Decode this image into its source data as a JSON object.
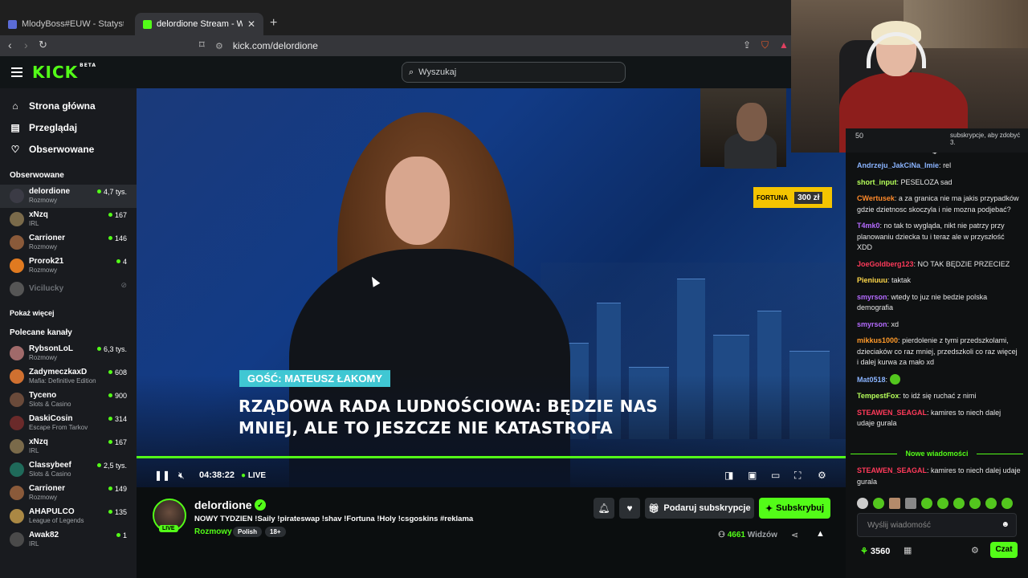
{
  "browser": {
    "tabs": [
      {
        "title": "MlodyBoss#EUW - Statystyki przywo",
        "favicon_color": "#5b6cd6"
      },
      {
        "title": "delordione Stream - Watch Live",
        "favicon_color": "#53fc18"
      }
    ],
    "new_tab": "+",
    "url": "kick.com/delordione"
  },
  "header": {
    "logo": "KICK",
    "logo_badge": "BETA",
    "search_placeholder": "Wyszukaj"
  },
  "sidebar": {
    "nav": [
      {
        "label": "Strona główna",
        "icon": "home-icon"
      },
      {
        "label": "Przeglądaj",
        "icon": "browse-icon"
      },
      {
        "label": "Obserwowane",
        "icon": "heart-icon"
      }
    ],
    "followed_title": "Obserwowane",
    "followed": [
      {
        "name": "delordione",
        "category": "Rozmowy",
        "viewers": "4,7 tys.",
        "avatar_color": "#3b3b45",
        "active": true
      },
      {
        "name": "xNzq",
        "category": "IRL",
        "viewers": "167",
        "avatar_color": "#7a6a4a"
      },
      {
        "name": "Carrioner",
        "category": "Rozmowy",
        "viewers": "146",
        "avatar_color": "#8a5a3a"
      },
      {
        "name": "Prorok21",
        "category": "Rozmowy",
        "viewers": "4",
        "avatar_color": "#e07a20"
      },
      {
        "name": "Vicilucky",
        "category": "",
        "viewers": "",
        "avatar_color": "#555",
        "offline": true
      }
    ],
    "show_more": "Pokaż więcej",
    "recommended_title": "Polecane kanały",
    "recommended": [
      {
        "name": "RybsonLoL",
        "category": "Rozmowy",
        "viewers": "6,3 tys.",
        "avatar_color": "#a06a6a"
      },
      {
        "name": "ZadymeczkaxD",
        "category": "Mafia: Definitive Edition",
        "viewers": "608",
        "avatar_color": "#d07030"
      },
      {
        "name": "Tyceno",
        "category": "Slots & Casino",
        "viewers": "900",
        "avatar_color": "#6a4a3a"
      },
      {
        "name": "DaskiCosin",
        "category": "Escape From Tarkov",
        "viewers": "314",
        "avatar_color": "#6a2a2a"
      },
      {
        "name": "xNzq",
        "category": "IRL",
        "viewers": "167",
        "avatar_color": "#7a6a4a"
      },
      {
        "name": "Classybeef",
        "category": "Slots & Casino",
        "viewers": "2,5 tys.",
        "avatar_color": "#1f6a5a"
      },
      {
        "name": "Carrioner",
        "category": "Rozmowy",
        "viewers": "149",
        "avatar_color": "#8a5a3a"
      },
      {
        "name": "AHAPULCO",
        "category": "League of Legends",
        "viewers": "135",
        "avatar_color": "#aa8844"
      },
      {
        "name": "Awak82",
        "category": "IRL",
        "viewers": "1",
        "avatar_color": "#4a4a4a"
      }
    ]
  },
  "video": {
    "guest_label": "GOŚĆ: MATEUSZ ŁAKOMY",
    "headline_1": "RZĄDOWA RADA LUDNOŚCIOWA: BĘDZIE NAS",
    "headline_2": "MNIEJ, ALE TO JESZCZE NIE KATASTROFA",
    "sponsor": "FORTUNA",
    "sponsor_amount": "300 zł",
    "time": "04:38:22",
    "live": "LIVE"
  },
  "stream": {
    "channel": "delordione",
    "live_badge": "LIVE",
    "title": "NOWY TYDZIEN !Saily !pirateswap !shav !Fortuna !Holy !csgoskins  #reklama",
    "category": "Rozmowy",
    "tags": [
      "Polish",
      "18+"
    ],
    "gift_label": "Podaruj subskrypcje",
    "subscribe_label": "Subskrybuj",
    "viewers": "4661",
    "viewers_label": "Widzów"
  },
  "chat": {
    "pinned_count": "50",
    "pinned_text": "subskrypcje, aby zdobyć 3.",
    "messages": [
      {
        "user": "Andrzeju_JakCiNa_Imie",
        "color": "#8ab4ff",
        "text": "rel"
      },
      {
        "user": "short_input",
        "color": "#b6ff5a",
        "text": "PESELOZA sad"
      },
      {
        "user": "CWertusek",
        "color": "#ff8a2a",
        "text": "a za granica nie ma jakis przypadków gdzie dzietnosc skoczyla i nie mozna podjebać?"
      },
      {
        "user": "T4mk0",
        "color": "#b56bff",
        "text": "no tak to wygląda, nikt nie patrzy przy planowaniu dziecka tu i teraz ale w przyszłość XDD"
      },
      {
        "user": "JoeGoldberg123",
        "color": "#ff3a5a",
        "text": "NO TAK BĘDZIE PRZECIEZ"
      },
      {
        "user": "Pieniuuu",
        "color": "#ffd84a",
        "text": "taktak"
      },
      {
        "user": "smyrson",
        "color": "#b56bff",
        "text": "wtedy to juz nie bedzie polska demografia"
      },
      {
        "user": "smyrson",
        "color": "#b56bff",
        "text": "xd"
      },
      {
        "user": "mikkus1000",
        "color": "#ff9a2a",
        "text": "pierdolenie z tymi przedszkolami, dzieciaków co raz mniej, przedszkoli co raz więcej i dalej kurwa za mało xd"
      },
      {
        "user": "Mat0518",
        "color": "#8ab4ff",
        "text": ""
      },
      {
        "user": "TempestFox",
        "color": "#b6ff5a",
        "text": "to idź się ruchać z nimi"
      },
      {
        "user": "STEAWEN_SEAGAL",
        "color": "#ff3a5a",
        "text": "kamires to niech dalej udaje gurala"
      }
    ],
    "new_messages_label": "Nowe wiadomości",
    "last_message": {
      "user": "STEAWEN_SEAGAL",
      "color": "#ff3a5a",
      "text": "kamires to niech dalej udaje gurala"
    },
    "input_placeholder": "Wyślij wiadomość",
    "points": "3560",
    "send_label": "Czat"
  },
  "colors": {
    "accent": "#53fc18",
    "bg": "#0b0e0f"
  }
}
